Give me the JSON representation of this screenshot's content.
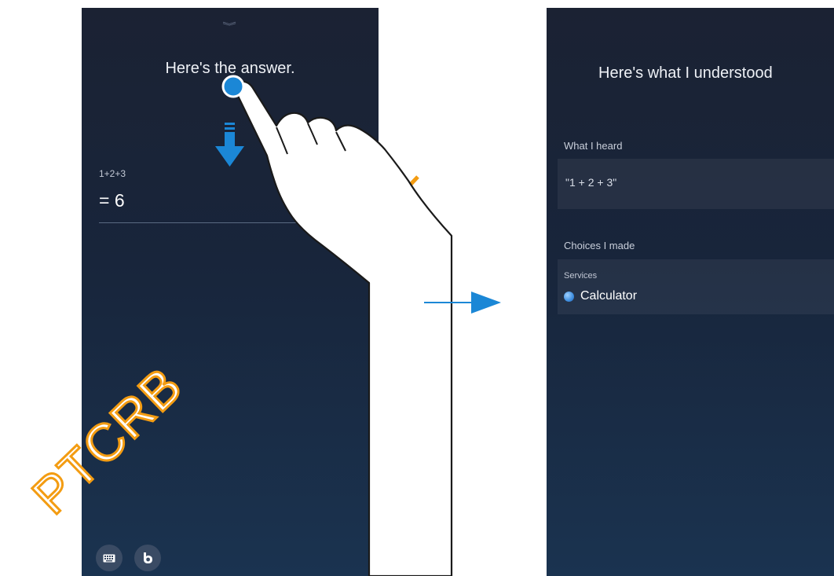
{
  "left_screen": {
    "collapse_icon": "double-chevron-down-icon",
    "title": "Here's the answer.",
    "expression": "1+2+3",
    "result": "= 6",
    "bottom_buttons": [
      {
        "icon": "keyboard-icon"
      },
      {
        "icon": "bixby-icon"
      }
    ]
  },
  "right_screen": {
    "title": "Here's what I understood",
    "what_i_heard_label": "What I heard",
    "heard_text": "\"1 + 2 + 3\"",
    "choices_label": "Choices I made",
    "services_label": "Services",
    "service": {
      "icon": "calculator-app-icon",
      "name": "Calculator"
    }
  },
  "annotations": {
    "gesture": "tap-and-drag-down-gesture",
    "transition_arrow": "right-arrow-icon",
    "watermark": "PTCRB"
  },
  "colors": {
    "screen_top": "#1b2233",
    "screen_bottom": "#1a3350",
    "arrow_blue": "#1b87d6",
    "watermark_orange": "#f39c12"
  }
}
